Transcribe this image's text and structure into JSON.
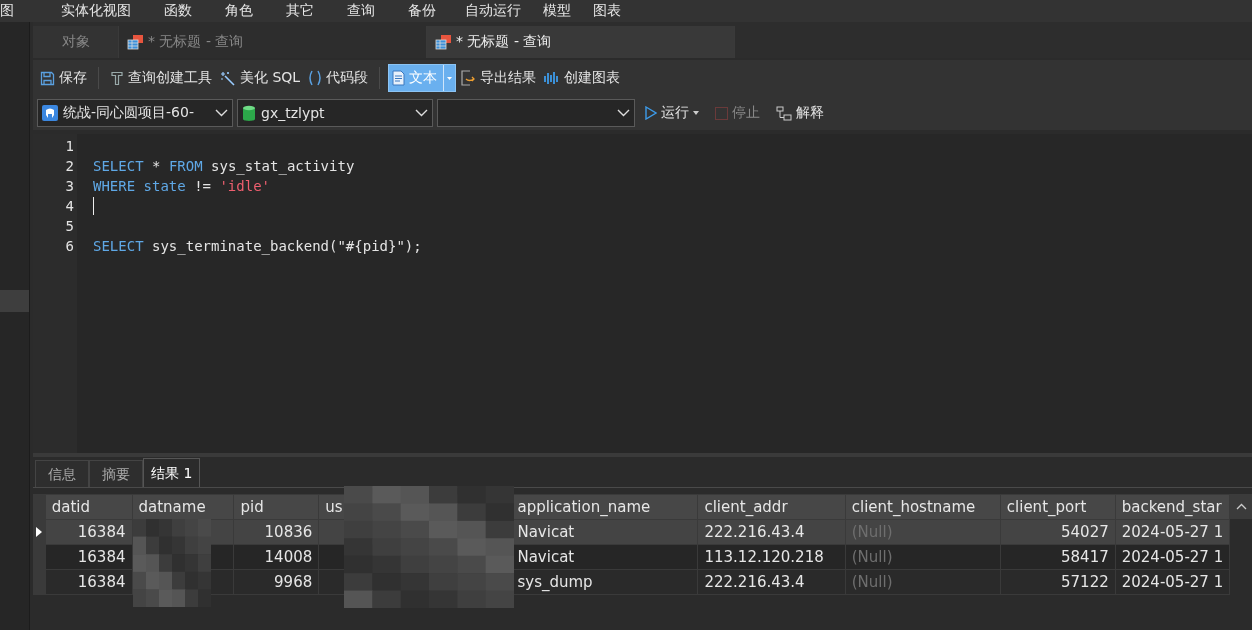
{
  "menu": [
    "图",
    "实体化视图",
    "函数",
    "角色",
    "其它",
    "查询",
    "备份",
    "自动运行",
    "模型",
    "图表"
  ],
  "tabs": [
    {
      "kind": "object",
      "label": "对象",
      "selected": false
    },
    {
      "kind": "query",
      "label": "* 无标题 - 查询",
      "selected": false
    },
    {
      "kind": "query",
      "label": "* 无标题 - 查询",
      "selected": true
    }
  ],
  "toolbar": [
    {
      "kind": "save",
      "label": "保存"
    },
    {
      "kind": "builder",
      "label": "查询创建工具"
    },
    {
      "kind": "beautify",
      "label": "美化 SQL"
    },
    {
      "kind": "snippet",
      "label": "代码段"
    },
    {
      "kind": "text",
      "label": "文本",
      "on": true
    },
    {
      "kind": "export",
      "label": "导出结果"
    },
    {
      "kind": "chart",
      "label": "创建图表"
    }
  ],
  "connection": {
    "server": "统战-同心圆项目-60-",
    "database": "gx_tzlypt"
  },
  "actions": [
    {
      "kind": "run",
      "label": "运行",
      "disabled": false
    },
    {
      "kind": "stop",
      "label": "停止",
      "disabled": true
    },
    {
      "kind": "explain",
      "label": "解释",
      "disabled": false
    }
  ],
  "editor": {
    "lines": [
      {
        "number": "1",
        "cursor": false
      },
      {
        "number": "2",
        "cursor": false,
        "tokens": [
          {
            "kind": "keyword",
            "text": "SELECT"
          },
          {
            "kind": "plain",
            "text": " * "
          },
          {
            "kind": "keyword",
            "text": "FROM"
          },
          {
            "kind": "plain",
            "text": " sys_stat_activity"
          }
        ]
      },
      {
        "number": "3",
        "cursor": false,
        "tokens": [
          {
            "kind": "keyword",
            "text": "WHERE state"
          },
          {
            "kind": "plain",
            "text": " != "
          },
          {
            "kind": "string",
            "text": "'idle'"
          }
        ]
      },
      {
        "number": "4",
        "cursor": true
      },
      {
        "number": "5",
        "cursor": false
      },
      {
        "number": "6",
        "cursor": false,
        "tokens": [
          {
            "kind": "keyword",
            "text": "SELECT"
          },
          {
            "kind": "plain",
            "text": " sys_terminate_backend(\"#{pid}\");"
          }
        ]
      }
    ]
  },
  "results": {
    "tabs": [
      {
        "label": "信息",
        "selected": false
      },
      {
        "label": "摘要",
        "selected": false
      },
      {
        "label": "结果 1",
        "selected": true
      }
    ],
    "columns": [
      {
        "label": "datid",
        "kind": "number"
      },
      {
        "label": "datname",
        "kind": "redacted"
      },
      {
        "label": "pid",
        "kind": "number"
      },
      {
        "label": "us",
        "kind": "redacted"
      },
      {
        "label": "application_name",
        "kind": "text"
      },
      {
        "label": "client_addr",
        "kind": "text"
      },
      {
        "label": "client_hostname",
        "kind": "null"
      },
      {
        "label": "client_port",
        "kind": "number"
      },
      {
        "label": "backend_star",
        "kind": "text"
      }
    ],
    "rows": [
      {
        "selected": true,
        "cells": [
          "16384",
          null,
          "10836",
          null,
          "Navicat",
          "222.216.43.4",
          "(Null)",
          "54027",
          "2024-05-27 1"
        ]
      },
      {
        "selected": false,
        "cells": [
          "16384",
          null,
          "14008",
          null,
          "Navicat",
          "113.12.120.218",
          "(Null)",
          "58417",
          "2024-05-27 1"
        ]
      },
      {
        "selected": false,
        "cells": [
          "16384",
          null,
          "9968",
          null,
          "sys_dump",
          "222.216.43.4",
          "(Null)",
          "57122",
          "2024-05-27 1"
        ]
      }
    ]
  }
}
